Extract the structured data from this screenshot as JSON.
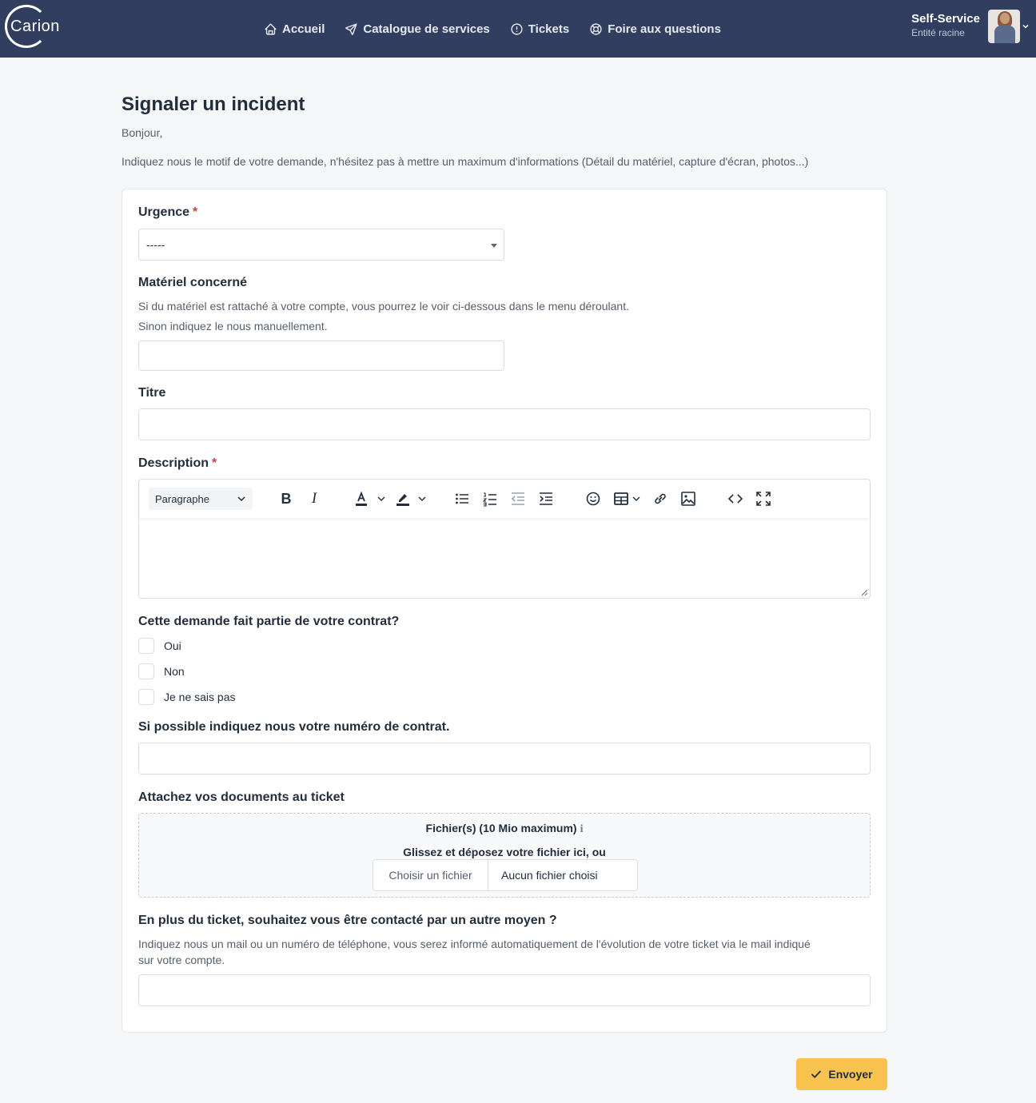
{
  "navbar": {
    "logo_text": "Carion",
    "links": [
      {
        "label": "Accueil",
        "icon": "home-icon"
      },
      {
        "label": "Catalogue de services",
        "icon": "send-icon"
      },
      {
        "label": "Tickets",
        "icon": "alert-circle-icon"
      },
      {
        "label": "Foire aux questions",
        "icon": "lifebuoy-icon"
      }
    ],
    "user": {
      "name": "Self-Service",
      "entity": "Entité racine"
    }
  },
  "page": {
    "title": "Signaler un incident",
    "intro_greeting": "Bonjour,",
    "intro_text": "Indiquez nous le motif de votre demande, n'hésitez pas à mettre un maximum d'informations (Détail du matériel, capture d'écran, photos...)"
  },
  "form": {
    "urgency": {
      "label": "Urgence",
      "required_mark": "*",
      "selected": "-----"
    },
    "material": {
      "label": "Matériel concerné",
      "help_line1": "Si du matériel est rattaché à votre compte, vous pourrez le voir ci-dessous dans le menu déroulant.",
      "help_line2": "Sinon indiquez le nous manuellement.",
      "value": ""
    },
    "title": {
      "label": "Titre",
      "value": ""
    },
    "description": {
      "label": "Description",
      "required_mark": "*",
      "format_select": "Paragraphe",
      "bold_glyph": "B",
      "italic_glyph": "I",
      "value": ""
    },
    "contract": {
      "label": "Cette demande fait partie de votre contrat?",
      "options": [
        {
          "label": "Oui",
          "checked": false
        },
        {
          "label": "Non",
          "checked": false
        },
        {
          "label": "Je ne sais pas",
          "checked": false
        }
      ]
    },
    "contract_number": {
      "label": "Si possible indiquez nous votre numéro de contrat.",
      "value": ""
    },
    "attachments": {
      "label": "Attachez vos documents au ticket",
      "title": "Fichier(s) (10 Mio maximum)",
      "info_glyph": "i",
      "drop_text": "Glissez et déposez votre fichier ici, ou",
      "choose_button": "Choisir un fichier",
      "status": "Aucun fichier choisi"
    },
    "contact": {
      "label": "En plus du ticket, souhaitez vous être contacté par un autre moyen ?",
      "help_line1": "Indiquez nous un mail ou un numéro de téléphone, vous serez informé automatiquement de l'évolution de votre ticket via le mail indiqué",
      "help_line2": "sur votre compte.",
      "value": ""
    },
    "submit_label": "Envoyer"
  },
  "colors": {
    "navbar_bg": "#323e5f",
    "page_bg": "#f5f6f8",
    "required": "#d63939",
    "submit_bg": "#f8c44f"
  }
}
